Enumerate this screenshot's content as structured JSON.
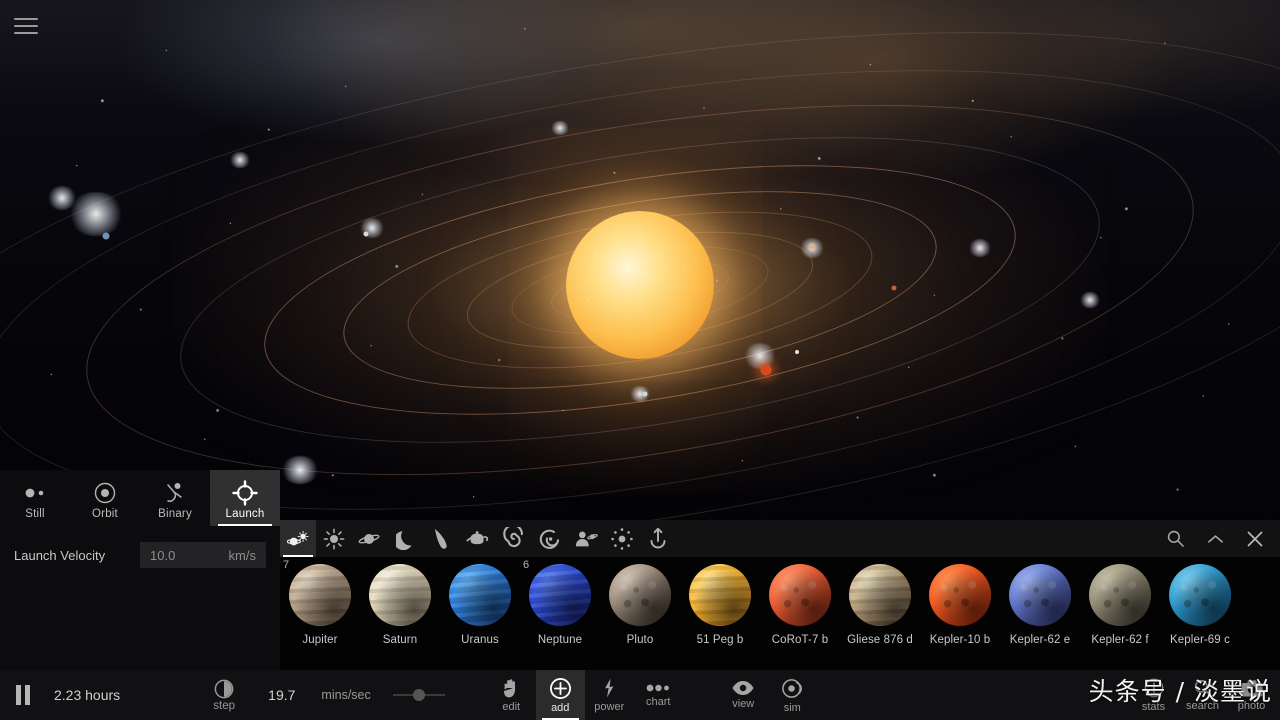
{
  "app": {
    "menu_icon": "hamburger-menu-icon",
    "watermark": "头条号 / 淡墨说"
  },
  "launch_panel": {
    "tabs": [
      {
        "label": "Still",
        "icon": "two-dots-icon",
        "active": false
      },
      {
        "label": "Orbit",
        "icon": "orbit-circle-icon",
        "active": false
      },
      {
        "label": "Binary",
        "icon": "binary-pair-icon",
        "active": false
      },
      {
        "label": "Launch",
        "icon": "crosshair-icon",
        "active": true
      }
    ],
    "velocity_label": "Launch Velocity",
    "velocity_value": "10.0",
    "velocity_unit": "km/s"
  },
  "browser": {
    "categories": [
      {
        "name": "planet-and-star-icon",
        "active": true
      },
      {
        "name": "star-icon",
        "active": false
      },
      {
        "name": "planet-icon",
        "active": false
      },
      {
        "name": "moon-icon",
        "active": false
      },
      {
        "name": "comet-icon",
        "active": false
      },
      {
        "name": "teapot-icon",
        "active": false
      },
      {
        "name": "spiral-galaxy-icon",
        "active": false
      },
      {
        "name": "galaxy-icon",
        "active": false
      },
      {
        "name": "person-icon",
        "active": false
      },
      {
        "name": "asteroid-belt-icon",
        "active": false
      },
      {
        "name": "rocket-launch-icon",
        "active": false
      }
    ],
    "search_icon": "search-icon",
    "collapse_icon": "chevron-up-icon",
    "close_icon": "close-icon",
    "objects": [
      {
        "name": "Jupiter",
        "badge": "7",
        "c1": "#e5d7c2",
        "c2": "#b9a186",
        "c3": "#8d7659",
        "bands": "jupiter"
      },
      {
        "name": "Saturn",
        "badge": "",
        "c1": "#f6efdc",
        "c2": "#e2d6b8",
        "c3": "#bfae8c",
        "bands": "saturn"
      },
      {
        "name": "Uranus",
        "badge": "",
        "c1": "#67b4f5",
        "c2": "#2f86e8",
        "c3": "#1a5fba",
        "bands": "ice"
      },
      {
        "name": "Neptune",
        "badge": "6",
        "c1": "#5a7df0",
        "c2": "#2f4fe0",
        "c3": "#1b2fa8",
        "bands": "ice"
      },
      {
        "name": "Pluto",
        "badge": "",
        "c1": "#d8ccbe",
        "c2": "#9b8a79",
        "c3": "#51463c",
        "bands": "rocky"
      },
      {
        "name": "51 Peg b",
        "badge": "",
        "c1": "#ffe08a",
        "c2": "#f9b52d",
        "c3": "#d98a14",
        "bands": "hotjup"
      },
      {
        "name": "CoRoT-7 b",
        "badge": "",
        "c1": "#ff9a72",
        "c2": "#ef5f35",
        "c3": "#a8331c",
        "bands": "lava"
      },
      {
        "name": "Gliese 876 d",
        "badge": "",
        "c1": "#eadfbf",
        "c2": "#bfa57d",
        "c3": "#7a6044",
        "bands": "jupiter"
      },
      {
        "name": "Kepler-10 b",
        "badge": "",
        "c1": "#ff9455",
        "c2": "#f55a22",
        "c3": "#b3340f",
        "bands": "lava"
      },
      {
        "name": "Kepler-62 e",
        "badge": "",
        "c1": "#9fb4ef",
        "c2": "#6377cf",
        "c3": "#3a4690",
        "bands": "rocky"
      },
      {
        "name": "Kepler-62 f",
        "badge": "",
        "c1": "#c9c3ab",
        "c2": "#968f78",
        "c3": "#5c5747",
        "bands": "rocky"
      },
      {
        "name": "Kepler-69 c",
        "badge": "",
        "c1": "#7fd0ef",
        "c2": "#2f9ad0",
        "c3": "#186a9a",
        "bands": "ocean"
      }
    ]
  },
  "bottom_bar": {
    "pause_icon": "pause-icon",
    "elapsed_time": "2.23 hours",
    "step_label": "step",
    "step_icon": "step-clock-icon",
    "rate_value": "19.7",
    "rate_unit": "mins/sec",
    "tools": [
      {
        "label": "edit",
        "icon": "hand-icon",
        "active": false
      },
      {
        "label": "add",
        "icon": "plus-circle-icon",
        "active": true
      },
      {
        "label": "power",
        "icon": "bolt-icon",
        "active": false
      },
      {
        "label": "chart",
        "icon": "dots-chart-icon",
        "active": false
      },
      {
        "label": "view",
        "icon": "eye-icon",
        "active": false
      },
      {
        "label": "sim",
        "icon": "sim-orbit-icon",
        "active": false
      }
    ],
    "right_tools": [
      {
        "label": "stats",
        "icon": "info-icon"
      },
      {
        "label": "search",
        "icon": "search-icon"
      },
      {
        "label": "photo",
        "icon": "camera-icon"
      }
    ]
  }
}
